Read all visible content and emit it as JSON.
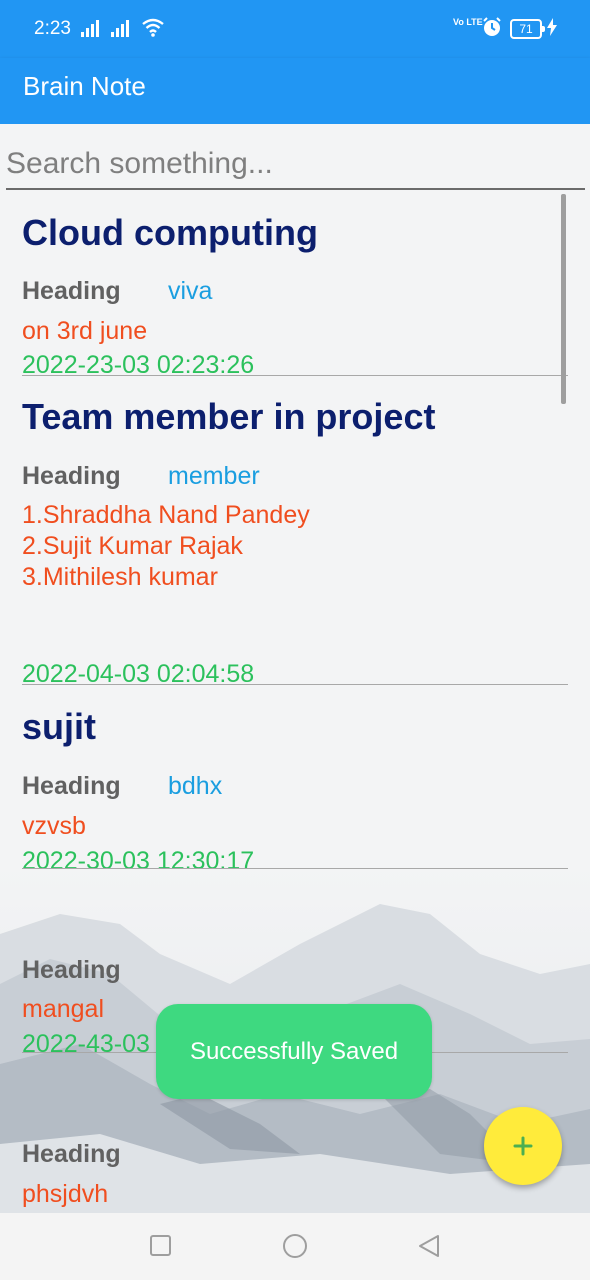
{
  "status_bar": {
    "time": "2:23",
    "network_label": "Vo LTE",
    "battery": "71",
    "icons": [
      "signal-icon",
      "wifi-icon",
      "volte-icon",
      "alarm-icon",
      "battery-icon",
      "charging-icon"
    ]
  },
  "app_bar": {
    "title": "Brain Note"
  },
  "search": {
    "placeholder": "Search something..."
  },
  "notes": [
    {
      "title": "Cloud computing",
      "label": "Heading",
      "heading": "viva",
      "body": "on 3rd june",
      "date": "2022-23-03 02:23:26"
    },
    {
      "title": "Team member in project",
      "label": "Heading",
      "heading": "member",
      "body": "1.Shraddha Nand Pandey\n2.Sujit Kumar Rajak\n3.Mithilesh kumar",
      "date": "2022-04-03 02:04:58"
    },
    {
      "title": "sujit",
      "label": "Heading",
      "heading": "bdhx",
      "body": "vzvsb",
      "date": "2022-30-03 12:30:17"
    },
    {
      "title": "",
      "label": "Heading",
      "heading": "",
      "body": "mangal",
      "date": "2022-43-03"
    },
    {
      "title": "",
      "label": "Heading",
      "heading": "",
      "body": "phsjdvh",
      "date": ""
    }
  ],
  "toast": {
    "message": "Successfully Saved"
  },
  "fab": {
    "icon": "plus-icon"
  },
  "nav_bar": {
    "icons": [
      "recents-square-icon",
      "home-circle-icon",
      "back-triangle-icon"
    ]
  },
  "colors": {
    "app_bar": "#2196f3",
    "title": "#0c1f6e",
    "heading": "#1a9ee0",
    "body": "#f04e1f",
    "date": "#2bc15c",
    "toast": "#3ed980",
    "fab": "#ffeb3b"
  }
}
